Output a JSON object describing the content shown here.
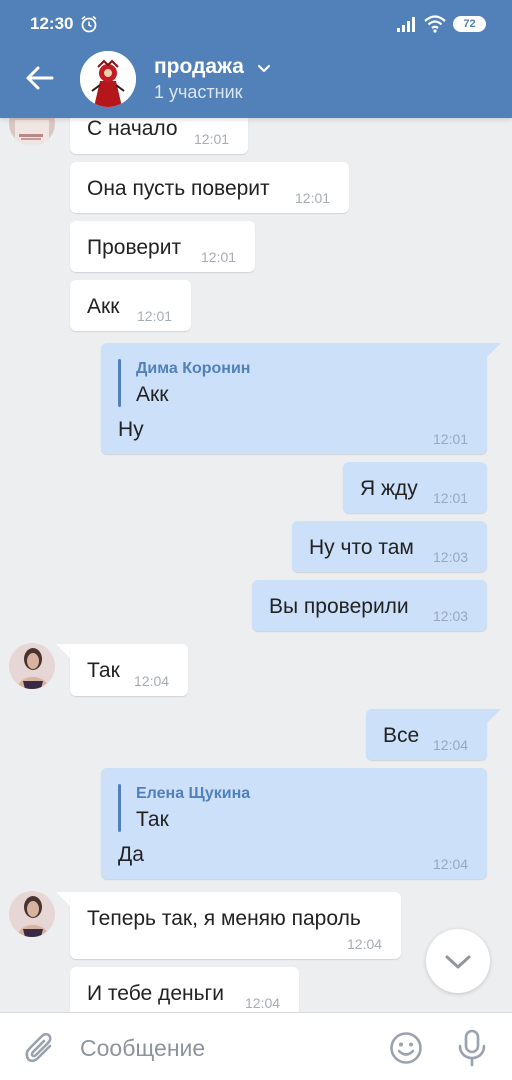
{
  "status_bar": {
    "time": "12:30",
    "battery": "72"
  },
  "header": {
    "title": "продажа",
    "subtitle": "1 участник"
  },
  "messages": [
    {
      "text": "С начало",
      "time": "12:01"
    },
    {
      "text": "Она пусть поверит",
      "time": "12:01"
    },
    {
      "text": "Проверит",
      "time": "12:01"
    },
    {
      "text": "Акк",
      "time": "12:01"
    },
    {
      "reply_name": "Дима Коронин",
      "reply_text": "Акк",
      "text": "Ну",
      "time": "12:01"
    },
    {
      "text": "Я жду",
      "time": "12:01"
    },
    {
      "text": "Ну что там",
      "time": "12:03"
    },
    {
      "text": "Вы проверили",
      "time": "12:03"
    },
    {
      "text": "Так",
      "time": "12:04"
    },
    {
      "text": "Все",
      "time": "12:04"
    },
    {
      "reply_name": "Елена Щукина",
      "reply_text": "Так",
      "text": "Да",
      "time": "12:04"
    },
    {
      "text": "Теперь так, я меняю пароль",
      "time": "12:04"
    },
    {
      "text": "И тебе деньги",
      "time": "12:04"
    }
  ],
  "composer": {
    "placeholder": "Сообщение"
  },
  "icons": {
    "back": "arrow-left-icon",
    "chevron": "chevron-down-icon",
    "attach": "paperclip-icon",
    "emoji": "smile-icon",
    "mic": "microphone-icon",
    "scroll": "chevron-down-icon"
  },
  "colors": {
    "header": "#5181b8",
    "background": "#edeef0",
    "incoming_bubble": "#ffffff",
    "outgoing_bubble": "#cce0fa",
    "accent": "#5181b8"
  }
}
